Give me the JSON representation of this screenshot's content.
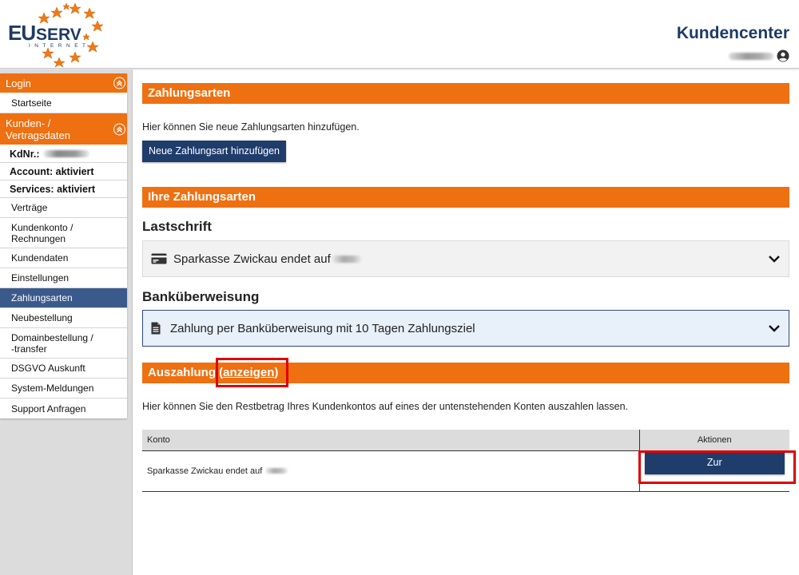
{
  "header": {
    "logo_text": "EUSERV",
    "logo_sub": "INTERNET",
    "title": "Kundencenter"
  },
  "sidebar": {
    "login_label": "Login",
    "startseite": "Startseite",
    "kunden_label_1": "Kunden- /",
    "kunden_label_2": "Vertragsdaten",
    "kdnr_label": "KdNr.:",
    "account_status": "Account: aktiviert",
    "services_status": "Services: aktiviert",
    "items": [
      {
        "label": "Verträge"
      },
      {
        "label_1": "Kundenkonto /",
        "label_2": "Rechnungen"
      },
      {
        "label": "Kundendaten"
      },
      {
        "label": "Einstellungen"
      },
      {
        "label": "Zahlungsarten",
        "active": true
      },
      {
        "label": "Neubestellung"
      },
      {
        "label_1": "Domainbestellung /",
        "label_2": "-transfer"
      },
      {
        "label": "DSGVO Auskunft"
      },
      {
        "label": "System-Meldungen"
      },
      {
        "label": "Support Anfragen"
      }
    ]
  },
  "main": {
    "zahlungsarten_title": "Zahlungsarten",
    "zahlungsarten_text": "Hier können Sie neue Zahlungsarten hinzufügen.",
    "add_button": "Neue Zahlungsart hinzufügen",
    "ihre_title": "Ihre Zahlungsarten",
    "lastschrift_title": "Lastschrift",
    "lastschrift_entry": "Sparkasse Zwickau endet auf",
    "bank_title": "Banküberweisung",
    "bank_entry": "Zahlung per Banküberweisung mit 10 Tagen Zahlungsziel",
    "auszahlung_title": "Auszahlung",
    "anzeigen_open": "(",
    "anzeigen_link": "anzeigen",
    "anzeigen_close": ")",
    "auszahlung_text": "Hier können Sie den Restbetrag Ihres Kundenkontos auf eines der untenstehenden Konten auszahlen lassen.",
    "table": {
      "col_konto": "Konto",
      "col_aktionen": "Aktionen",
      "row_konto": "Sparkasse Zwickau endet auf",
      "row_button": "Zur Auszahlungsbestätigung"
    }
  },
  "colors": {
    "accent_orange": "#ee7011",
    "brand_navy": "#1f3d6b",
    "highlight_red": "#e00000"
  }
}
